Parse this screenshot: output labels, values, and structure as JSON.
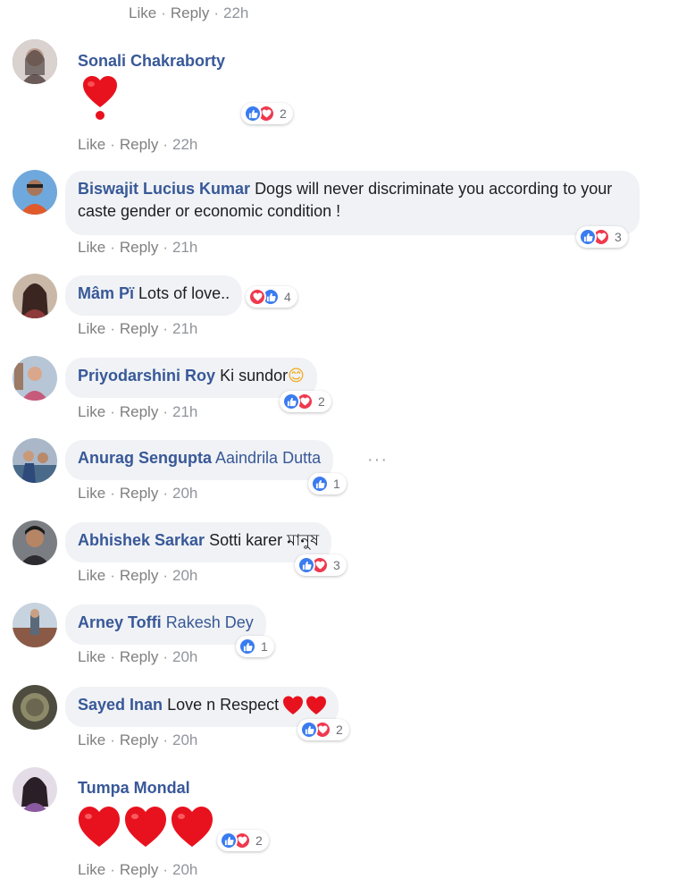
{
  "top_partial": {
    "like": "Like",
    "reply": "Reply",
    "time": "22h"
  },
  "comments": [
    {
      "name": "Sonali Chakraborty",
      "text": "",
      "reaction_count": "2",
      "like": "Like",
      "reply": "Reply",
      "time": "22h",
      "avatar_color": "#8a7a78"
    },
    {
      "name": "Biswajit Lucius Kumar",
      "text": "Dogs will never discriminate you according to your caste gender or economic condition !",
      "reaction_count": "3",
      "like": "Like",
      "reply": "Reply",
      "time": "21h",
      "avatar_color": "#3f7fb5"
    },
    {
      "name": "Mâm Pï",
      "text": "Lots of love..",
      "reaction_count": "4",
      "like": "Like",
      "reply": "Reply",
      "time": "21h",
      "avatar_color": "#5a4640"
    },
    {
      "name": "Priyodarshini Roy",
      "text": "Ki sundor",
      "emoji": "😊",
      "reaction_count": "2",
      "like": "Like",
      "reply": "Reply",
      "time": "21h",
      "avatar_color": "#b97f7a"
    },
    {
      "name": "Anurag Sengupta",
      "mention": "Aaindrila Dutta",
      "reaction_count": "1",
      "like": "Like",
      "reply": "Reply",
      "time": "20h",
      "avatar_color": "#6f86a8"
    },
    {
      "name": "Abhishek Sarkar",
      "text": "Sotti karer মানুষ",
      "reaction_count": "3",
      "like": "Like",
      "reply": "Reply",
      "time": "20h",
      "avatar_color": "#4a4a4e"
    },
    {
      "name": "Arney Toffi",
      "mention": "Rakesh Dey",
      "reaction_count": "1",
      "like": "Like",
      "reply": "Reply",
      "time": "20h",
      "avatar_color": "#9aa3ad"
    },
    {
      "name": "Sayed Inan",
      "text": "Love n Respect",
      "reaction_count": "2",
      "like": "Like",
      "reply": "Reply",
      "time": "20h",
      "avatar_color": "#6b6a56"
    },
    {
      "name": "Tumpa Mondal",
      "text": "",
      "reaction_count": "2",
      "like": "Like",
      "reply": "Reply",
      "time": "20h",
      "avatar_color": "#7d6f8a"
    }
  ],
  "colors": {
    "name_blue": "#385898",
    "bubble_bg": "#f0f2f5",
    "like_blue": "#3a7bf0",
    "love_red": "#f0384e",
    "meta_gray": "#90949c"
  },
  "icons": {
    "like": "thumbs-up-icon",
    "love": "heart-icon",
    "more": "more-options-icon"
  }
}
